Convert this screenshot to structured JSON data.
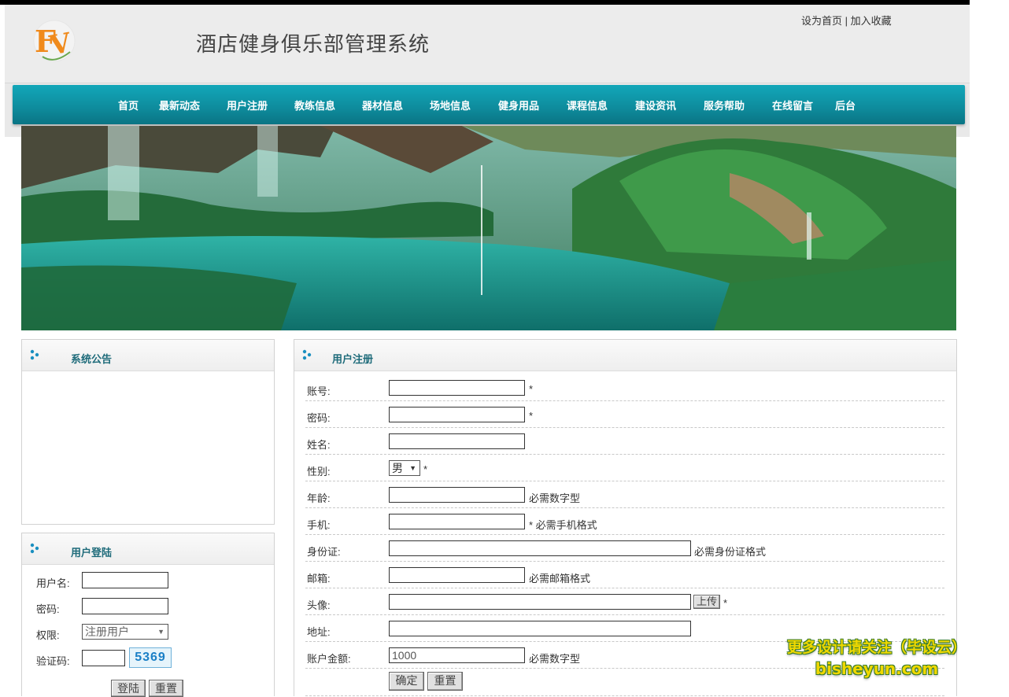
{
  "header": {
    "title": "酒店健身俱乐部管理系统",
    "set_home": "设为首页",
    "separator": "|",
    "add_favorite": "加入收藏"
  },
  "nav": [
    "首页",
    "最新动态",
    "用户注册",
    "教练信息",
    "器材信息",
    "场地信息",
    "健身用品",
    "课程信息",
    "建设资讯",
    "服务帮助",
    "在线留言",
    "后台"
  ],
  "notice": {
    "title": "系统公告"
  },
  "login": {
    "title": "用户登陆",
    "username_label": "用户名:",
    "password_label": "密码:",
    "role_label": "权限:",
    "role_value": "注册用户",
    "captcha_label": "验证码:",
    "captcha_value": "5369",
    "login_button": "登陆",
    "reset_button": "重置"
  },
  "register": {
    "title": "用户注册",
    "fields": {
      "account": {
        "label": "账号:",
        "hint": "*"
      },
      "password": {
        "label": "密码:",
        "hint": "*"
      },
      "name": {
        "label": "姓名:"
      },
      "gender": {
        "label": "性别:",
        "value": "男",
        "hint": "*"
      },
      "age": {
        "label": "年龄:",
        "hint": "必需数字型"
      },
      "phone": {
        "label": "手机:",
        "hint": "* 必需手机格式"
      },
      "id_card": {
        "label": "身份证:",
        "hint": "必需身份证格式"
      },
      "email": {
        "label": "邮箱:",
        "hint": "必需邮箱格式"
      },
      "avatar": {
        "label": "头像:",
        "upload": "上传",
        "hint": "*"
      },
      "address": {
        "label": "地址:"
      },
      "balance": {
        "label": "账户金额:",
        "value": "1000",
        "hint": "必需数字型"
      }
    },
    "submit_button": "确定",
    "reset_button": "重置"
  },
  "watermark": {
    "line1": "更多设计请关注（毕设云）",
    "line2": "bisheyun.com"
  },
  "colors": {
    "nav_bg": "#0e8b9c",
    "header_bg": "#ececec",
    "panel_title": "#1e6b7a",
    "watermark": "#f0d800"
  }
}
